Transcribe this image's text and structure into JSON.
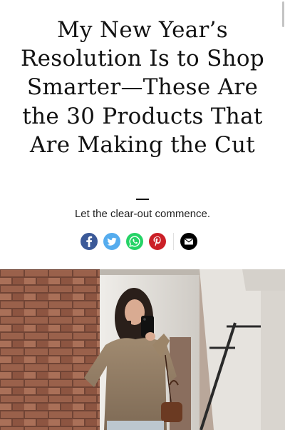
{
  "article": {
    "headline": "My New Year’s Resolution Is to Shop Smarter—These Are the 30 Products That Are Making the Cut",
    "dek": "Let the clear-out commence."
  },
  "share": {
    "buttons": [
      {
        "network": "facebook",
        "icon": "facebook-icon",
        "color": "#3b5998"
      },
      {
        "network": "twitter",
        "icon": "twitter-icon",
        "color": "#55acee"
      },
      {
        "network": "whatsapp",
        "icon": "whatsapp-icon",
        "color": "#25d366"
      },
      {
        "network": "pinterest",
        "icon": "pinterest-icon",
        "color": "#cb2027"
      },
      {
        "network": "email",
        "icon": "envelope-icon",
        "color": "#000000"
      }
    ]
  },
  "hero_image": {
    "subject": "mirror selfie",
    "icon": "photo"
  }
}
